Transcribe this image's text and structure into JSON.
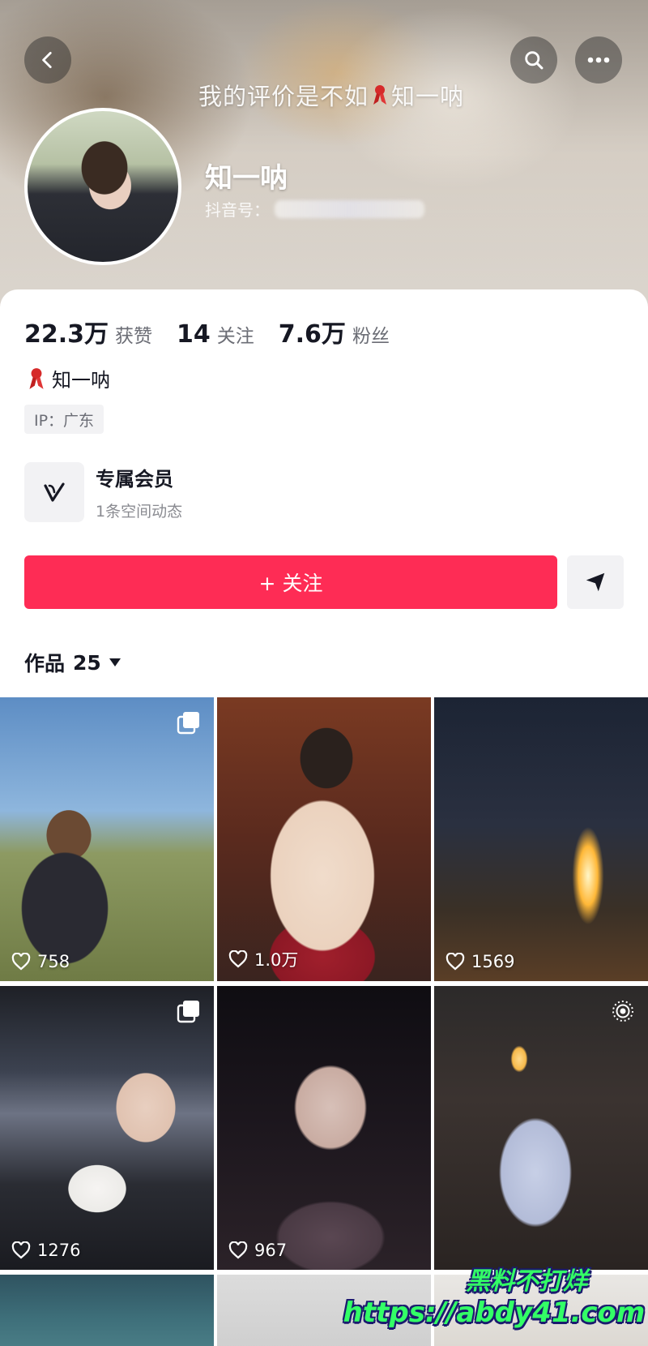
{
  "header": {
    "tagline_text": "我的评价是不如",
    "tagline_name": "知一呐",
    "nickname": "知一呐",
    "account_label": "抖音号："
  },
  "stats": [
    {
      "value": "22.3万",
      "label": "获赞"
    },
    {
      "value": "14",
      "label": "关注"
    },
    {
      "value": "7.6万",
      "label": "粉丝"
    }
  ],
  "badge": {
    "name": "知一呐"
  },
  "ip": {
    "text": "IP：广东"
  },
  "member": {
    "title": "专属会员",
    "subtitle": "1条空间动态"
  },
  "actions": {
    "follow_label": "+ 关注"
  },
  "works": {
    "label": "作品",
    "count": "25"
  },
  "grid": {
    "tiles": [
      {
        "likes": "758"
      },
      {
        "likes": "1.0万"
      },
      {
        "likes": "1569"
      },
      {
        "likes": "1276"
      },
      {
        "likes": "967"
      },
      {
        "likes": ""
      }
    ]
  },
  "watermark": {
    "line1": "黑料不打烊",
    "line2": "https://abdy41.com"
  },
  "colors": {
    "accent": "#fe2c55",
    "text": "#161823",
    "muted": "#6b6d75"
  }
}
